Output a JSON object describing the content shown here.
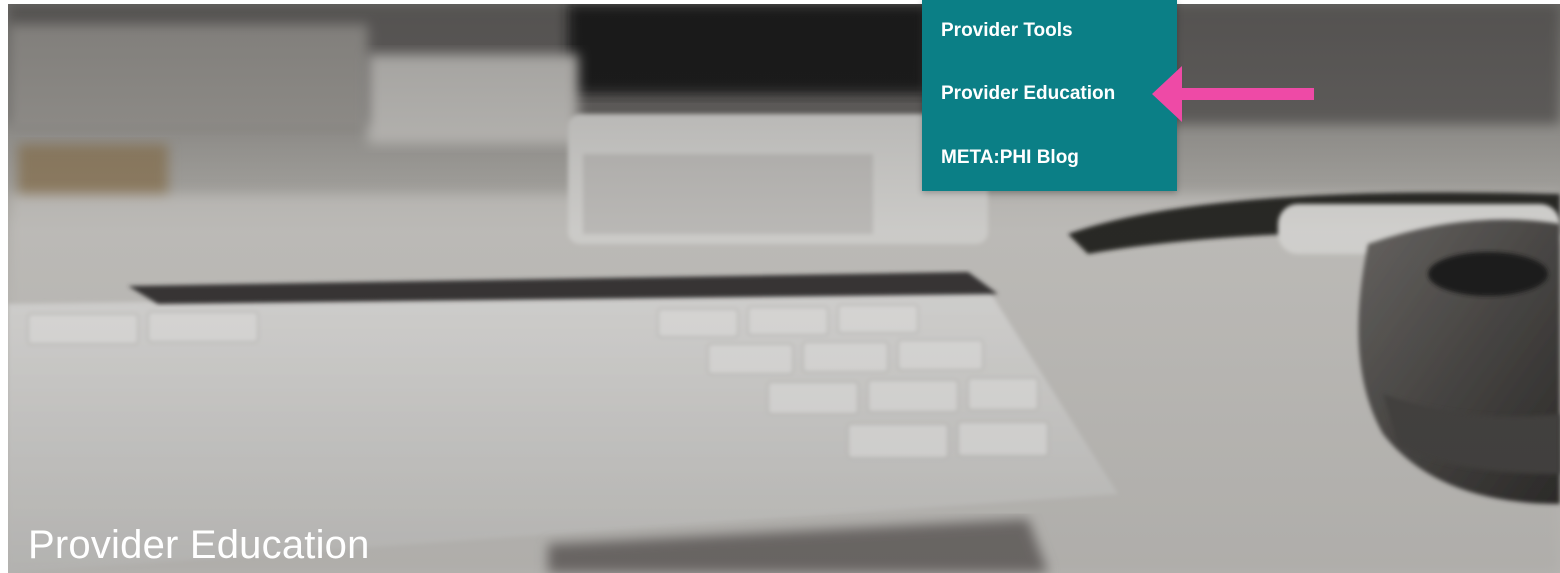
{
  "dropdown": {
    "items": [
      {
        "label": "Provider Tools"
      },
      {
        "label": "Provider Education"
      },
      {
        "label": "META:PHI Blog"
      }
    ],
    "background_color": "#0b7f86",
    "text_color": "#ffffff"
  },
  "hero": {
    "title": "Provider Education"
  },
  "annotation": {
    "arrow_color": "#ee4aa6",
    "icon": "arrow-left-icon"
  }
}
